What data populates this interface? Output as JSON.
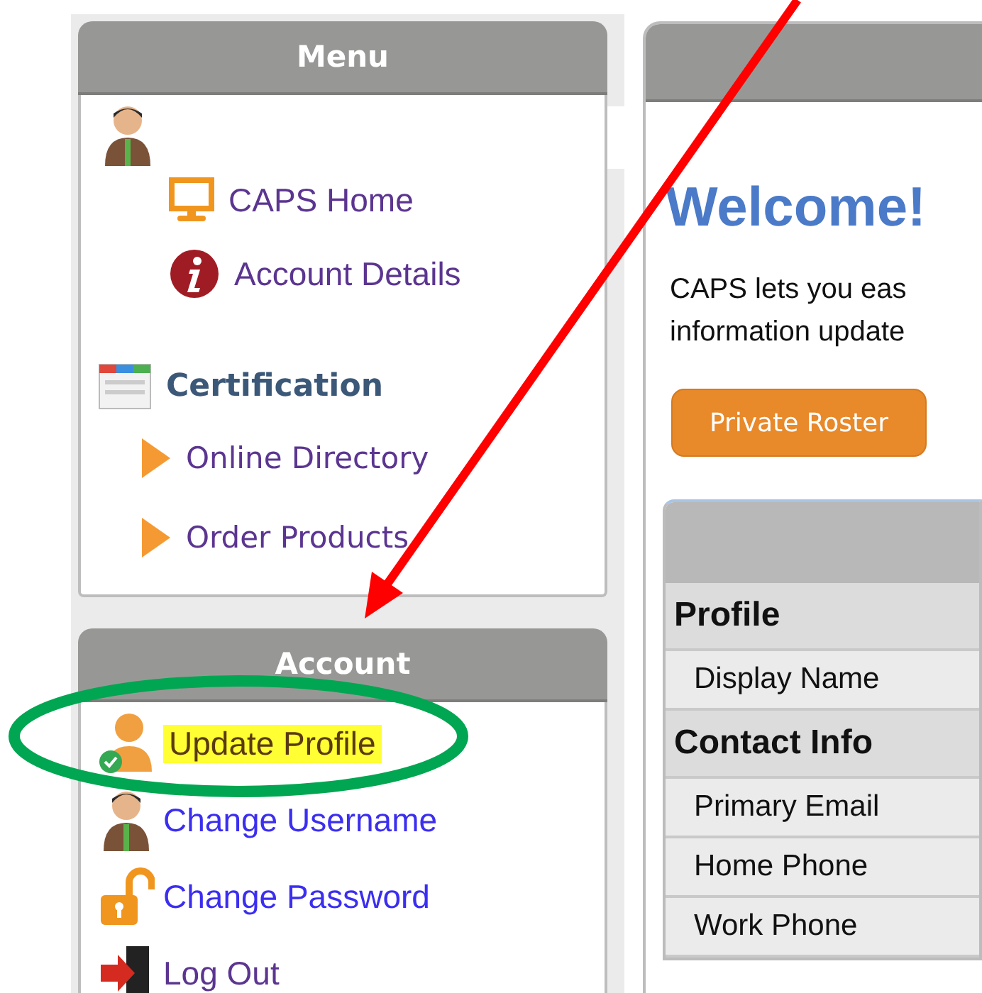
{
  "menu": {
    "title": "Menu",
    "items": [
      {
        "kind": "user"
      },
      {
        "kind": "monitor",
        "label": "CAPS Home",
        "visited": true
      },
      {
        "kind": "info",
        "label": "Account Details",
        "visited": true
      },
      {
        "kind": "calendar",
        "label": "Certification",
        "children": [
          {
            "kind": "triangle",
            "label": "Online Directory",
            "visited": true
          },
          {
            "kind": "triangle",
            "label": "Order Products",
            "visited": true
          }
        ]
      }
    ]
  },
  "account": {
    "title": "Account",
    "items": [
      {
        "kind": "user-check",
        "label": "Update Profile",
        "visited": true,
        "highlighted": true
      },
      {
        "kind": "user",
        "label": "Change Username",
        "visited": false,
        "highlighted": false
      },
      {
        "kind": "lock",
        "label": "Change Password",
        "visited": false,
        "highlighted": false
      },
      {
        "kind": "exit",
        "label": "Log Out",
        "visited": true,
        "highlighted": false
      }
    ]
  },
  "main": {
    "heading": "Welcome!",
    "intro": [
      "CAPS lets you eas",
      "information update"
    ],
    "button": "Private Roster",
    "table": {
      "rows": [
        {
          "kind": "section",
          "label": "Profile"
        },
        {
          "kind": "field",
          "label": "Display Name"
        },
        {
          "kind": "section",
          "label": "Contact Info"
        },
        {
          "kind": "field",
          "label": "Primary Email"
        },
        {
          "kind": "field",
          "label": "Home Phone"
        },
        {
          "kind": "field",
          "label": "Work Phone"
        }
      ]
    }
  },
  "annotations": {
    "arrow": true,
    "ellipse": true
  }
}
